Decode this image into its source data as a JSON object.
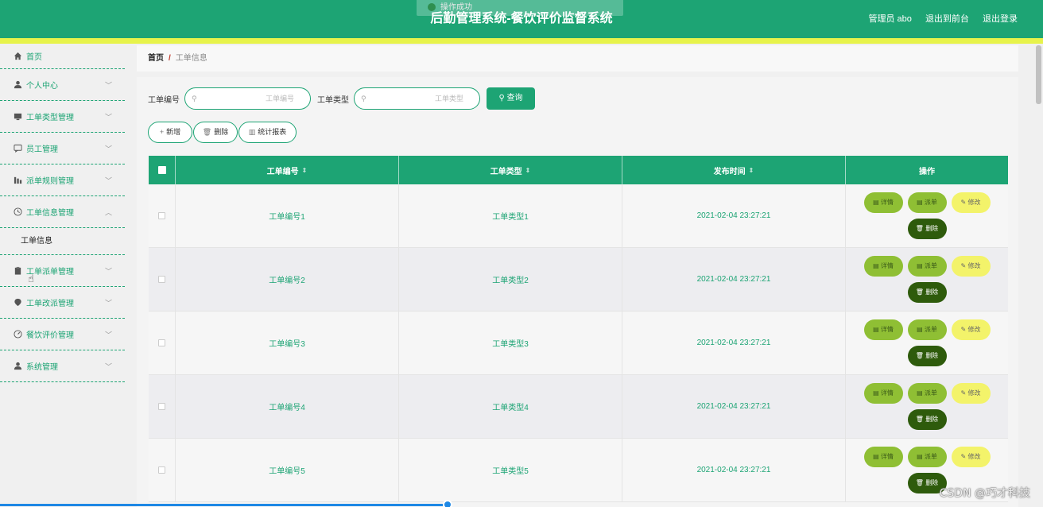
{
  "header": {
    "title": "后勤管理系统-餐饮评价监督系统",
    "toast": "操作成功",
    "user": "管理员 abo",
    "to_front": "退出到前台",
    "logout": "退出登录"
  },
  "sidebar": {
    "items": [
      {
        "label": "首页",
        "icon": "home-icon"
      },
      {
        "label": "个人中心",
        "icon": "user-icon"
      },
      {
        "label": "工单类型管理",
        "icon": "monitor-icon"
      },
      {
        "label": "员工管理",
        "icon": "chat-icon"
      },
      {
        "label": "派单规则管理",
        "icon": "chart-icon"
      },
      {
        "label": "工单信息管理",
        "icon": "clock-icon"
      },
      {
        "label": "工单派单管理",
        "icon": "clipboard-icon"
      },
      {
        "label": "工单改派管理",
        "icon": "pin-icon"
      },
      {
        "label": "餐饮评价管理",
        "icon": "gauge-icon"
      },
      {
        "label": "系统管理",
        "icon": "user-icon"
      }
    ],
    "sub_item": "工单信息"
  },
  "breadcrumb": {
    "home": "首页",
    "separator": "/",
    "current": "工单信息"
  },
  "search": {
    "label_no": "工单编号",
    "placeholder_no": "工单编号",
    "label_type": "工单类型",
    "placeholder_type": "工单类型",
    "query": "查询"
  },
  "actions": {
    "add": "新增",
    "delete": "删除",
    "report": "统计报表"
  },
  "table": {
    "headers": [
      "工单编号",
      "工单类型",
      "发布时间",
      "操作"
    ],
    "rows": [
      {
        "no": "工单编号1",
        "type": "工单类型1",
        "time": "2021-02-04 23:27:21"
      },
      {
        "no": "工单编号2",
        "type": "工单类型2",
        "time": "2021-02-04 23:27:21"
      },
      {
        "no": "工单编号3",
        "type": "工单类型3",
        "time": "2021-02-04 23:27:21"
      },
      {
        "no": "工单编号4",
        "type": "工单类型4",
        "time": "2021-02-04 23:27:21"
      },
      {
        "no": "工单编号5",
        "type": "工单类型5",
        "time": "2021-02-04 23:27:21"
      }
    ],
    "row_buttons": {
      "detail": "详情",
      "assign": "派单",
      "edit": "修改",
      "delete": "删除"
    }
  },
  "watermark": "CSDN @巧才科技",
  "colors": {
    "primary": "#1da474",
    "accent_strip": "#e7f34b",
    "pill_green": "#8fbf34",
    "pill_yellow": "#f3f36a",
    "pill_dark": "#2e5b0c"
  }
}
